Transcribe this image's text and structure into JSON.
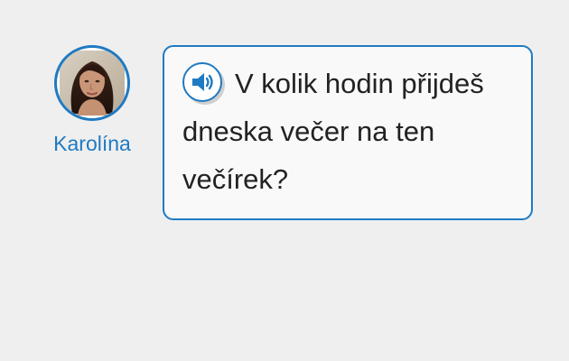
{
  "speaker": {
    "name": "Karolína",
    "avatar_icon": "woman-portrait-avatar"
  },
  "message": {
    "audio_icon": "speaker-volume-icon",
    "text": "V kolik hodin přijdeš dneska večer na ten večírek?"
  },
  "colors": {
    "accent": "#1f7ac2",
    "background": "#efefef",
    "bubble": "#f9f9f9",
    "text": "#222222"
  }
}
